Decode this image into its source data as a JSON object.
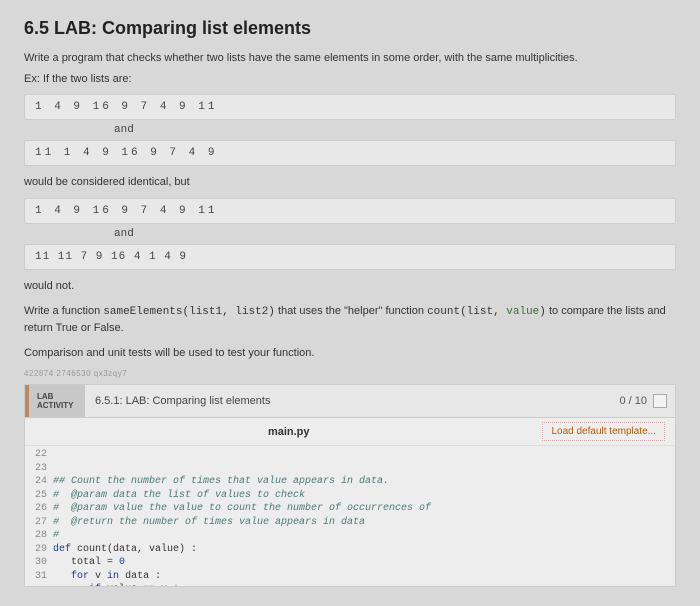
{
  "title": "6.5 LAB: Comparing list elements",
  "intro1": "Write a program that checks whether two lists have the same elements in some order, with the same multiplicities.",
  "intro2": "Ex: If the two lists are:",
  "list1a": "1  4  9  16  9  7  4  9  11",
  "and": "and",
  "list1b": "11  1  4  9  16  9  7  4  9",
  "mid1": "would be considered identical, but",
  "list2a": "1  4  9  16  9  7  4  9  11",
  "list2b": "11 11 7 9 16 4 1 4 9",
  "wouldnot": "would not.",
  "func_pre": "Write a function ",
  "func_sig": "sameElements(list1, list2)",
  "func_mid": " that uses the \"helper\" function ",
  "func_count": "count(list, ",
  "func_val": "value",
  "func_close": ")",
  "func_post": " to compare the lists and return True or False.",
  "tests": "Comparison and unit tests will be used to test your function.",
  "hash": "422874 2746530 qx3zqy7",
  "lab_tag1": "LAB",
  "lab_tag2": "ACTIVITY",
  "lab_title": "6.5.1: LAB: Comparing list elements",
  "score": "0 / 10",
  "filename": "main.py",
  "tmpl_btn": "Load default template...",
  "gutter": [
    "22",
    "23",
    "24",
    "25",
    "26",
    "27",
    "28",
    "29",
    "30",
    "31"
  ],
  "code": {
    "l22": "",
    "l23": "## Count the number of times that value appears in data.",
    "l24": "#  @param data the list of values to check",
    "l25": "#  @param value the value to count the number of occurrences of",
    "l26": "#  @return the number of times value appears in data",
    "l27": "#",
    "l28a": "def",
    "l28b": " count(data, value) :",
    "l29a": "   total = ",
    "l29b": "0",
    "l30a": "   ",
    "l30b": "for",
    "l30c": " v ",
    "l30d": "in",
    "l30e": " data :",
    "l31a": "      ",
    "l31b": "if",
    "l31c": " value == v :"
  }
}
